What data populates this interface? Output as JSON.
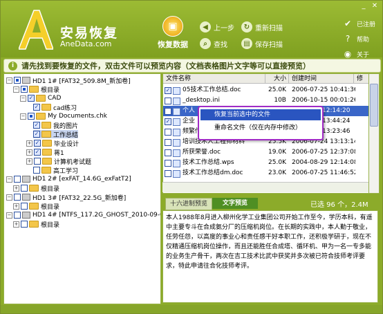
{
  "app": {
    "brand_cn": "安易恢复",
    "brand_en": "AneData.com",
    "main_button": "恢复数据",
    "nav": {
      "prev": "上一步",
      "rescan": "重新扫描",
      "find": "查找",
      "save_scan": "保存扫描"
    },
    "right_menu": {
      "register": "已注册",
      "help": "帮助",
      "about": "关于"
    }
  },
  "hint": "请先找到要恢复的文件，双击文件可以预览内容（文档表格图片文字等可以直接预览）",
  "tree": [
    {
      "label": "HD1  1# [FAT32_509.8M_新加卷]"
    },
    {
      "label": "根目录"
    },
    {
      "label": "CAD"
    },
    {
      "label": "cad练习"
    },
    {
      "label": "My Documents.chk"
    },
    {
      "label": "我的图片"
    },
    {
      "label": "工作总结"
    },
    {
      "label": "毕业设计"
    },
    {
      "label": "蒋1"
    },
    {
      "label": "计算机考试题"
    },
    {
      "label": "高工学习"
    },
    {
      "label": "HD1  2# [exFAT_14.6G_exFatT2]"
    },
    {
      "label": "根目录"
    },
    {
      "label": "HD1  3# [FAT32_22.5G_新加卷]"
    },
    {
      "label": "根目录"
    },
    {
      "label": "HD1  4# [NTFS_117.2G_GHOST_2010-09-03]"
    },
    {
      "label": "根目录"
    }
  ],
  "files": {
    "headers": {
      "name": "文件名称",
      "size": "大小",
      "created": "创建时间",
      "modified": "修"
    },
    "rows": [
      {
        "name": "05技术工作总结.doc",
        "size": "25.0K",
        "date": "2006-07-25 10:41:36"
      },
      {
        "name": "_desktop.ini",
        "size": "10B",
        "date": "2006-10-15 00:01:26"
      },
      {
        "name": "个人",
        "size": "",
        "date": "12:14:20"
      },
      {
        "name": "企业",
        "size": "",
        "date": "13:44:24"
      },
      {
        "name": "频繁传",
        "size": "",
        "date": "13:23:46"
      },
      {
        "name": "培训技术人工程师材料",
        "size": "25.5K",
        "date": "2006-07-24 13:13:14"
      },
      {
        "name": "所获荣誉.doc",
        "size": "19.0K",
        "date": "2006-07-25 12:37:08"
      },
      {
        "name": "技术工作总结.wps",
        "size": "25.0K",
        "date": "2004-08-29 12:14:08"
      },
      {
        "name": "技术工作总结dm.doc",
        "size": "23.0K",
        "date": "2006-07-25 11:46:52"
      }
    ]
  },
  "context_menu": {
    "recover": "恢复当前选中的文件",
    "rename": "重命名文件（仅在内存中修改）"
  },
  "preview": {
    "tab_hex": "十六进制预览",
    "tab_text": "文字预览",
    "selected_count": "已选 96 个，2.4M",
    "text": "本人1988年8月进入柳州化学工业集团公司开始工作至今，学历本科，有遥中主要专斗在合成氨分厂的压缩机岗位。在长期的实践中，本人勤于敬业，任劳任怨，以高度的事业心和责任感干好本职工作，还积极学研于，现在不仅精通压缩机岗位操作，而且还能胜任合成塔、循环机、甲为一名一专多能的业务生产骨干，两次在吉工技术比武中获奖并多次被已符合技师考评要求，特此申请往合化技师考评。"
  }
}
